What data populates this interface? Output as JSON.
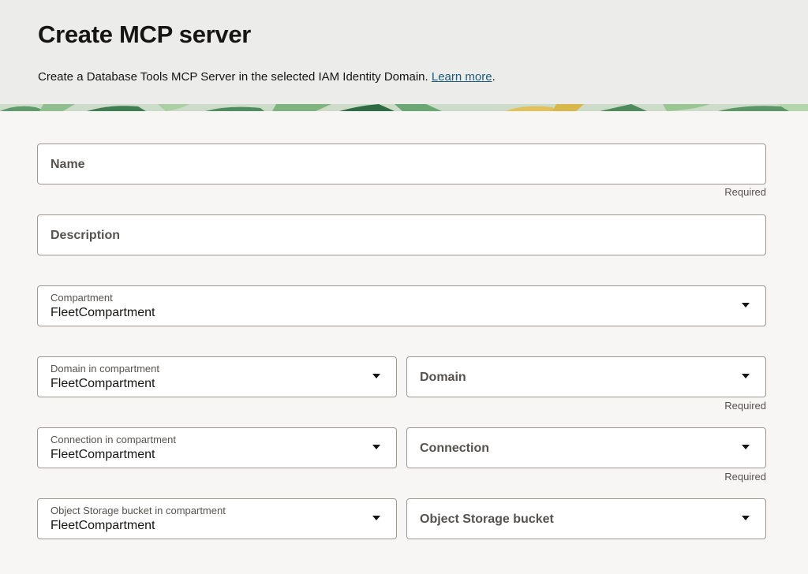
{
  "header": {
    "title": "Create MCP server",
    "subtitle": "Create a Database Tools MCP Server in the selected IAM Identity Domain.",
    "learn_more": "Learn more",
    "subtitle_end": "."
  },
  "form": {
    "name": {
      "placeholder": "Name",
      "helper": "Required"
    },
    "description": {
      "placeholder": "Description"
    },
    "compartment": {
      "label": "Compartment",
      "value": "FleetCompartment",
      "icon": "chevron-down-icon"
    },
    "domain_compartment": {
      "label": "Domain in compartment",
      "value": "FleetCompartment"
    },
    "domain": {
      "placeholder": "Domain",
      "helper": "Required"
    },
    "connection_compartment": {
      "label": "Connection in compartment",
      "value": "FleetCompartment"
    },
    "connection": {
      "placeholder": "Connection",
      "helper": "Required"
    },
    "bucket_compartment": {
      "label": "Object Storage bucket in compartment",
      "value": "FleetCompartment"
    },
    "bucket": {
      "placeholder": "Object Storage bucket"
    }
  },
  "colors": {
    "link": "#1a5a78",
    "header_bg": "#ececea",
    "page_bg": "#f8f6f4"
  }
}
